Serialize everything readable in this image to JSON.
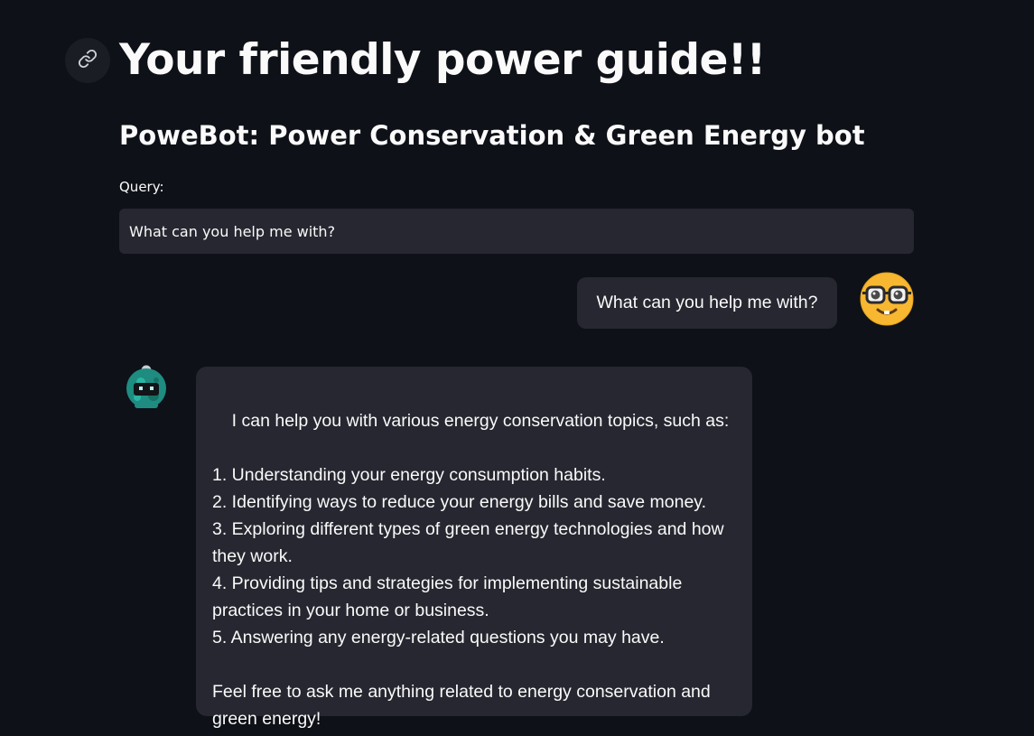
{
  "page": {
    "title": "Your friendly power guide!!",
    "subtitle": "PoweBot: Power Conservation & Green Energy bot",
    "anchor_icon": "link-icon"
  },
  "query": {
    "label": "Query:",
    "value": "What can you help me with?"
  },
  "chat": {
    "messages": [
      {
        "role": "user",
        "avatar_icon": "nerd-face-icon",
        "text": "What can you help me with?"
      },
      {
        "role": "assistant",
        "avatar_icon": "robot-icon",
        "text": "I can help you with various energy conservation topics, such as:\n\n1. Understanding your energy consumption habits.\n2. Identifying ways to reduce your energy bills and save money.\n3. Exploring different types of green energy technologies and how they work.\n4. Providing tips and strategies for implementing sustainable practices in your home or business.\n5. Answering any energy-related questions you may have.\n\nFeel free to ask me anything related to energy conservation and green energy!"
      }
    ]
  },
  "colors": {
    "background": "#0e1117",
    "surface": "#262730",
    "text": "#fafafa",
    "emoji_yellow": "#f7b731",
    "robot_teal": "#1e8c80"
  }
}
